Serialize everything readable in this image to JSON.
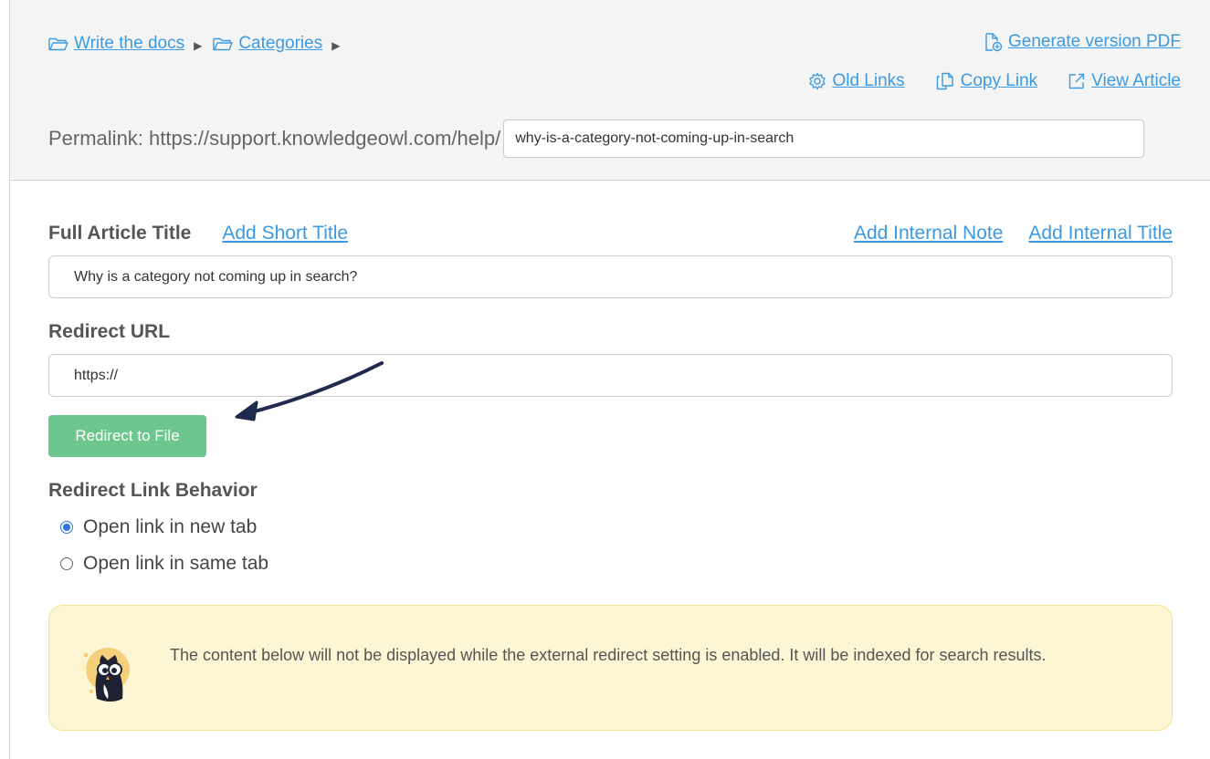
{
  "breadcrumb": {
    "items": [
      "Write the docs",
      "Categories"
    ]
  },
  "header": {
    "generate_pdf": "Generate version PDF",
    "old_links": "Old Links",
    "copy_link": "Copy Link",
    "view_article": "View Article"
  },
  "permalink": {
    "label": "Permalink: https://support.knowledgeowl.com/help/",
    "value": "why-is-a-category-not-coming-up-in-search"
  },
  "title_section": {
    "label": "Full Article Title",
    "add_short_title": "Add Short Title",
    "add_internal_note": "Add Internal Note",
    "add_internal_title": "Add Internal Title",
    "value": "Why is a category not coming up in search?"
  },
  "redirect": {
    "label": "Redirect URL",
    "value": "https://",
    "button": "Redirect to File"
  },
  "behavior": {
    "label": "Redirect Link Behavior",
    "options": [
      {
        "label": "Open link in new tab",
        "checked": true
      },
      {
        "label": "Open link in same tab",
        "checked": false
      }
    ]
  },
  "notice": {
    "text": "The content below will not be displayed while the external redirect setting is enabled. It will be indexed for search results."
  },
  "colors": {
    "link": "#3b9ae1",
    "button_green": "#6cc68e",
    "notice_bg": "#fcf6d5",
    "notice_border": "#f2e294",
    "arrow": "#1f2a4e"
  },
  "icons": [
    "folder-icon",
    "caret-right-icon",
    "pdf-file-icon",
    "gear-icon",
    "copy-icon",
    "external-link-icon",
    "owl-icon"
  ]
}
